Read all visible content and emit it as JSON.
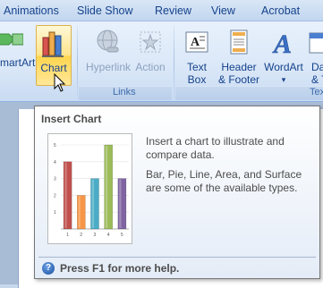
{
  "tabs": [
    "Animations",
    "Slide Show",
    "Review",
    "View",
    "Acrobat"
  ],
  "ribbon": {
    "smartart_label": "martArt",
    "chart_label": "Chart",
    "hyperlink_label": "Hyperlink",
    "action_label": "Action",
    "links_group_label": "Links",
    "textbox_line1": "Text",
    "textbox_line2": "Box",
    "header_line1": "Header",
    "header_line2": "& Footer",
    "wordart_label": "WordArt",
    "wordart_arrow": "▾",
    "date_partial_line1": "Da",
    "date_partial_line2": "& Ti",
    "text_group_partial": "Tex"
  },
  "tooltip": {
    "title": "Insert Chart",
    "description": "Insert a chart to illustrate and compare data.",
    "types": "Bar, Pie, Line, Area, and Surface are some of the available types.",
    "help": "Press F1 for more help.",
    "help_icon": "?"
  },
  "chart_data": {
    "type": "bar",
    "categories": [
      "1",
      "2",
      "3",
      "4",
      "5"
    ],
    "values": [
      4,
      2,
      3,
      5,
      3
    ],
    "ylim": [
      0,
      5
    ],
    "yticks": [
      "5",
      "4",
      "3",
      "2",
      "1"
    ],
    "colors": [
      "#c0504d",
      "#f79646",
      "#4bacc6",
      "#9bbb59",
      "#8064a2"
    ]
  }
}
